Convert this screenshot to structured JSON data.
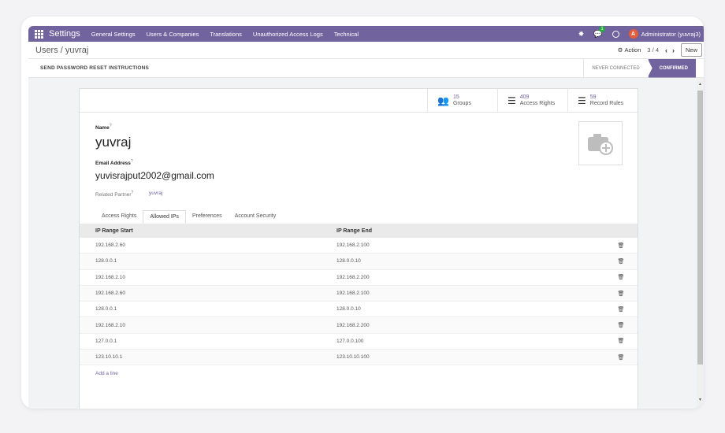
{
  "navbar": {
    "brand": "Settings",
    "menu": [
      "General Settings",
      "Users & Companies",
      "Translations",
      "Unauthorized Access Logs",
      "Technical"
    ],
    "chat_badge": "1",
    "avatar_letter": "A",
    "user_name": "Administrator (yuvraj3)"
  },
  "control": {
    "breadcrumb_parent": "Users",
    "breadcrumb_sep": "/",
    "breadcrumb_current": "yuvraj",
    "action_label": "Action",
    "pager": "3 / 4",
    "new_label": "New"
  },
  "statusbar": {
    "reset_label": "SEND PASSWORD RESET INSTRUCTIONS",
    "state_never": "NEVER CONNECTED",
    "state_confirmed": "CONFIRMED"
  },
  "stats": [
    {
      "num": "15",
      "label": "Groups",
      "icon": "users-icon"
    },
    {
      "num": "409",
      "label": "Access Rights",
      "icon": "list-icon"
    },
    {
      "num": "59",
      "label": "Record Rules",
      "icon": "list-icon"
    }
  ],
  "form": {
    "name_label": "Name",
    "name_value": "yuvraj",
    "email_label": "Email Address",
    "email_value": "yuvisrajput2002@gmail.com",
    "partner_label": "Related Partner",
    "partner_value": "yuvraj",
    "help_mark": "?"
  },
  "tabs": [
    "Access Rights",
    "Allowed IPs",
    "Preferences",
    "Account Security"
  ],
  "grid": {
    "headers": [
      "IP Range Start",
      "IP Range End"
    ],
    "rows": [
      [
        "192.168.2.60",
        "192.168.2.100"
      ],
      [
        "128.0.0.1",
        "128.0.0.10"
      ],
      [
        "192.168.2.10",
        "192.168.2.200"
      ],
      [
        "192.168.2.60",
        "192.168.2.100"
      ],
      [
        "128.0.0.1",
        "128.0.0.10"
      ],
      [
        "192.168.2.10",
        "192.168.2.200"
      ],
      [
        "127.0.0.1",
        "127.0.0.100"
      ],
      [
        "123.10.10.1",
        "123.10.10.100"
      ]
    ],
    "add_line": "Add a line"
  },
  "colors": {
    "brand": "#71639e"
  }
}
